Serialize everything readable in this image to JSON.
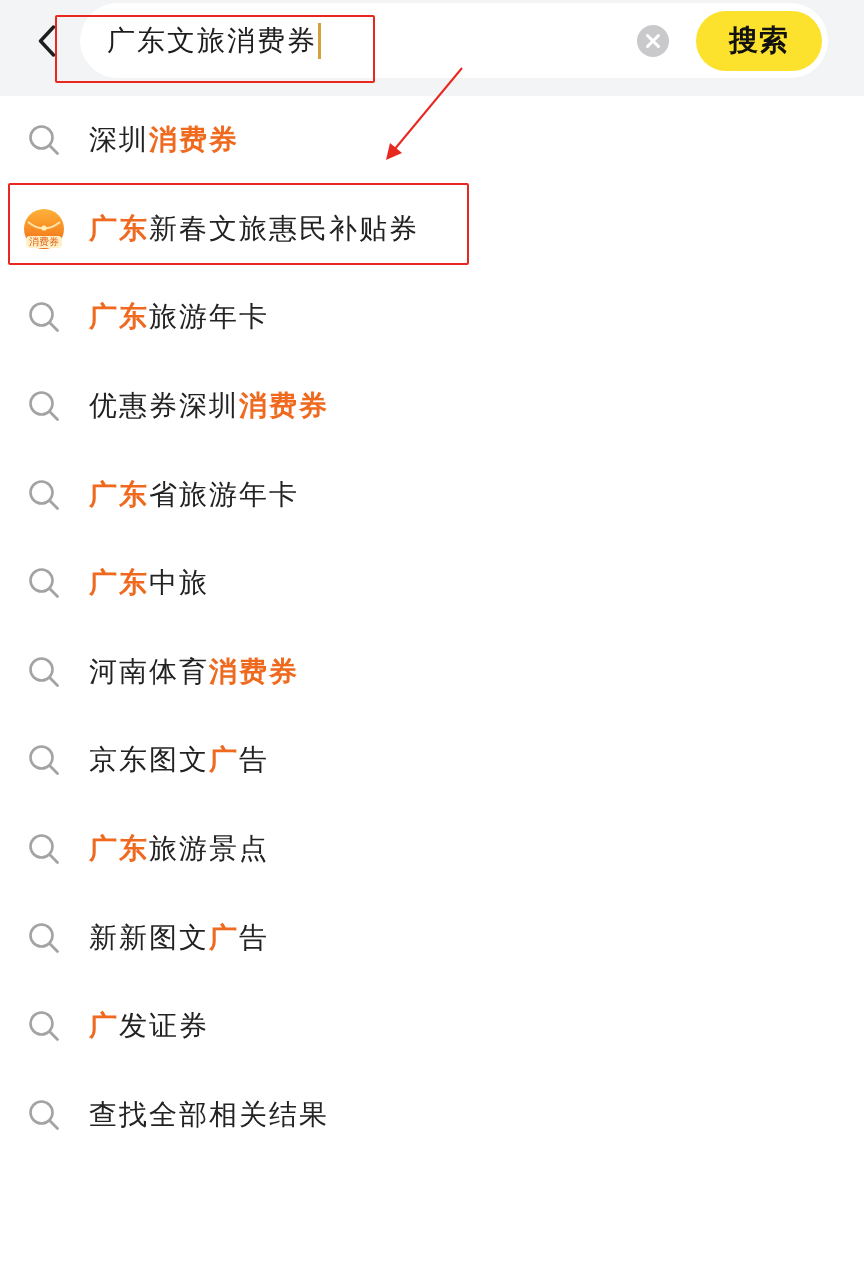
{
  "search": {
    "value": "广东文旅消费券",
    "annotated": true,
    "button": "搜索"
  },
  "suggestions": [
    {
      "kind": "query",
      "text": "深圳**消费券**",
      "annotated": false
    },
    {
      "kind": "coupon",
      "text": "**广东**新春文旅惠民补贴券",
      "badge": "消费券",
      "annotated": true
    },
    {
      "kind": "query",
      "text": "**广东**旅游年卡",
      "annotated": false
    },
    {
      "kind": "query",
      "text": "优惠券深圳**消费券**",
      "annotated": false
    },
    {
      "kind": "query",
      "text": "**广东**省旅游年卡",
      "annotated": false
    },
    {
      "kind": "query",
      "text": "**广东**中旅",
      "annotated": false
    },
    {
      "kind": "query",
      "text": "河南体育**消费券**",
      "annotated": false
    },
    {
      "kind": "query",
      "text": "京东图文**广**告",
      "annotated": false
    },
    {
      "kind": "query",
      "text": "**广东**旅游景点",
      "annotated": false
    },
    {
      "kind": "query",
      "text": "新新图文**广**告",
      "annotated": false
    },
    {
      "kind": "query",
      "text": "**广**发证券",
      "annotated": false
    },
    {
      "kind": "query",
      "text": "查找全部相关结果",
      "annotated": false
    }
  ],
  "arrow_annotation": true
}
